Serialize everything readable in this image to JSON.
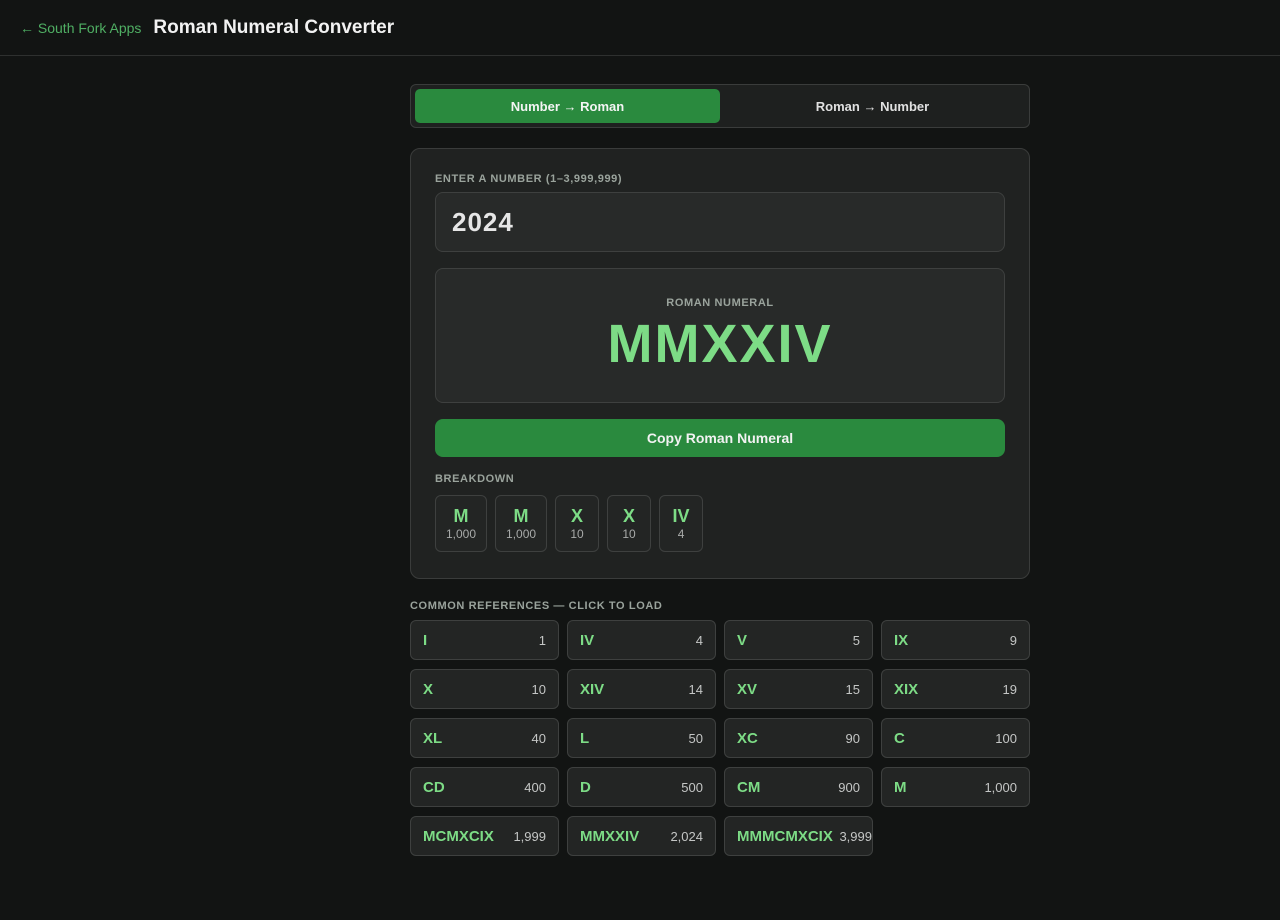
{
  "header": {
    "back_label": "← South Fork Apps",
    "title": "Roman Numeral Converter"
  },
  "mode": {
    "options": [
      "Number → Roman",
      "Roman → Number"
    ],
    "active": "Number → Roman"
  },
  "input": {
    "label": "ENTER A NUMBER (1–3,999,999)",
    "value": "2024"
  },
  "result": {
    "label": "ROMAN NUMERAL",
    "value": "MMXXIV"
  },
  "copy_label": "Copy Roman Numeral",
  "breakdown": {
    "label": "BREAKDOWN",
    "items": [
      {
        "numeral": "M",
        "value": "1,000"
      },
      {
        "numeral": "M",
        "value": "1,000"
      },
      {
        "numeral": "X",
        "value": "10"
      },
      {
        "numeral": "X",
        "value": "10"
      },
      {
        "numeral": "IV",
        "value": "4"
      }
    ]
  },
  "references": {
    "label": "COMMON REFERENCES — CLICK TO LOAD",
    "items": [
      {
        "numeral": "I",
        "value": "1"
      },
      {
        "numeral": "IV",
        "value": "4"
      },
      {
        "numeral": "V",
        "value": "5"
      },
      {
        "numeral": "IX",
        "value": "9"
      },
      {
        "numeral": "X",
        "value": "10"
      },
      {
        "numeral": "XIV",
        "value": "14"
      },
      {
        "numeral": "XV",
        "value": "15"
      },
      {
        "numeral": "XIX",
        "value": "19"
      },
      {
        "numeral": "XL",
        "value": "40"
      },
      {
        "numeral": "L",
        "value": "50"
      },
      {
        "numeral": "XC",
        "value": "90"
      },
      {
        "numeral": "C",
        "value": "100"
      },
      {
        "numeral": "CD",
        "value": "400"
      },
      {
        "numeral": "D",
        "value": "500"
      },
      {
        "numeral": "CM",
        "value": "900"
      },
      {
        "numeral": "M",
        "value": "1,000"
      },
      {
        "numeral": "MCMXCIX",
        "value": "1,999"
      },
      {
        "numeral": "MMXXIV",
        "value": "2,024"
      },
      {
        "numeral": "MMMCMXCIX",
        "value": "3,999"
      }
    ]
  },
  "colors": {
    "accent": "#2a8a3e",
    "numeral_green": "#7ddc86",
    "background": "#121413"
  }
}
